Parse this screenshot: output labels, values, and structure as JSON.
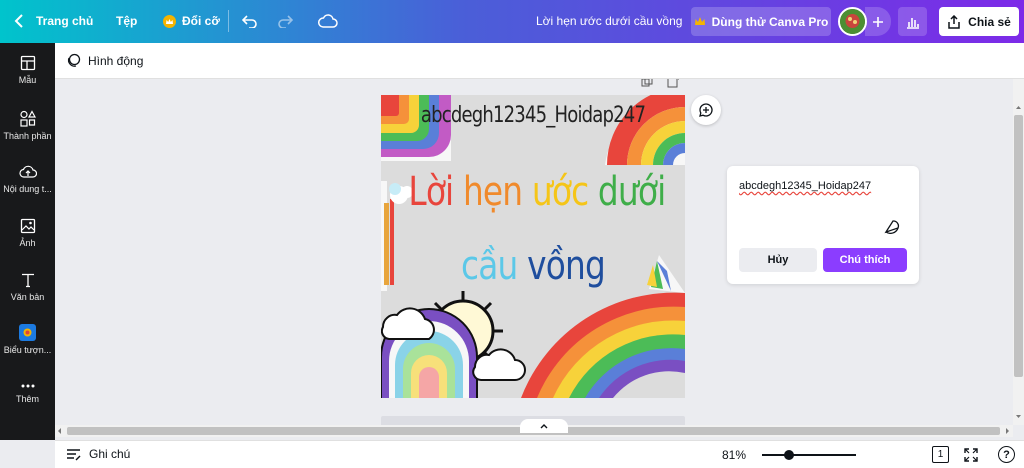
{
  "topbar": {
    "home": "Trang chủ",
    "file": "Tệp",
    "resize": "Đổi cỡ",
    "doc_title": "Lời hẹn ước dưới cầu vồng",
    "try_pro": "Dùng thử Canva Pro",
    "share": "Chia sẻ"
  },
  "subbar": {
    "animate": "Hình động"
  },
  "sidebar": {
    "items": [
      {
        "label": "Mẫu",
        "icon": "template-icon"
      },
      {
        "label": "Thành phần",
        "icon": "elements-icon"
      },
      {
        "label": "Nội dung t...",
        "icon": "upload-icon"
      },
      {
        "label": "Ảnh",
        "icon": "photo-icon"
      },
      {
        "label": "Văn bản",
        "icon": "text-icon"
      },
      {
        "label": "Biểu tượn...",
        "icon": "logo-app-icon"
      },
      {
        "label": "Thêm",
        "icon": "more-icon"
      }
    ]
  },
  "design": {
    "watermark": "abcdegh12345_Hoidap247",
    "title_words_line1": [
      {
        "text": "Lời",
        "color": "#e8453c"
      },
      {
        "text": "hẹn",
        "color": "#f08a2c"
      },
      {
        "text": "ước",
        "color": "#f5c518"
      },
      {
        "text": "dưới",
        "color": "#3fae49"
      }
    ],
    "title_words_line2": [
      {
        "text": "cầu",
        "color": "#5bc8e8"
      },
      {
        "text": "vồng",
        "color": "#1f4e9e"
      }
    ]
  },
  "comment": {
    "text": "abcdegh12345_Hoidap247",
    "cancel": "Hủy",
    "submit": "Chú thích"
  },
  "bottombar": {
    "notes": "Ghi chú",
    "zoom": "81%",
    "zoom_level": 0.29,
    "page_count": "1"
  },
  "colors": {
    "accent": "#8b3dff",
    "sidebar_bg": "#18191b"
  }
}
